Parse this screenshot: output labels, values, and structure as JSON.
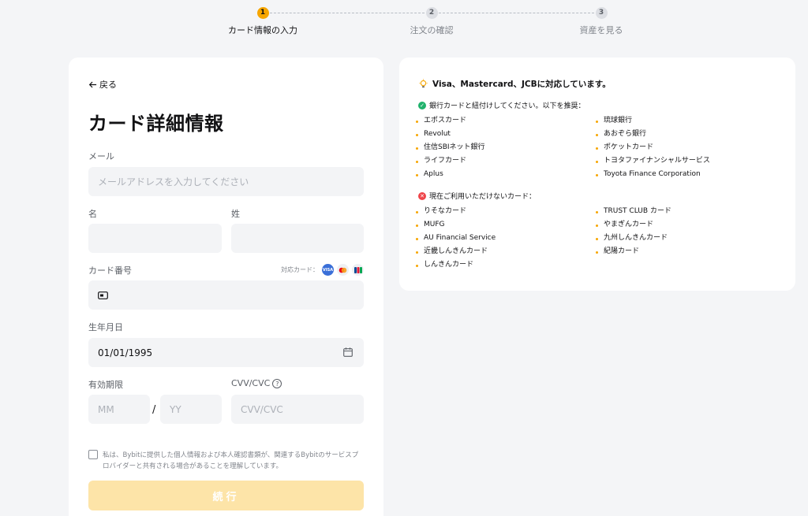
{
  "stepper": {
    "steps": [
      {
        "num": "1",
        "label": "カード情報の入力"
      },
      {
        "num": "2",
        "label": "注文の確認"
      },
      {
        "num": "3",
        "label": "資産を見る"
      }
    ]
  },
  "form": {
    "back_label": "戻る",
    "title": "カード詳細情報",
    "email_label": "メール",
    "email_placeholder": "メールアドレスを入力してください",
    "first_name_label": "名",
    "last_name_label": "姓",
    "card_number_label": "カード番号",
    "supported_cards_label": "対応カード：",
    "card_logos": [
      "VISA",
      "MC",
      "JCB"
    ],
    "dob_label": "生年月日",
    "dob_value": "01/01/1995",
    "expiry_label": "有効期限",
    "mm_placeholder": "MM",
    "slash": "/",
    "yy_placeholder": "YY",
    "cvv_label": "CVV/CVC",
    "cvv_placeholder": "CVV/CVC",
    "consent_text": "私は、Bybitに提供した個人情報および本人確認書類が、関連するBybitのサービスプロバイダーと共有される場合があることを理解しています。",
    "submit_label": "続行"
  },
  "info": {
    "title": "Visa、Mastercard、JCBに対応しています。",
    "recommended_heading": "銀行カードと紐付けしてください。以下を推奨：",
    "recommended_left": [
      "エポスカード",
      "Revolut",
      "住信SBIネット銀行",
      "ライフカード",
      "Aplus"
    ],
    "recommended_right": [
      "琉球銀行",
      "あおぞら銀行",
      "ポケットカード",
      "トヨタファイナンシャルサービス",
      "Toyota Finance Corporation"
    ],
    "unavailable_heading": "現在ご利用いただけないカード：",
    "unavailable_left": [
      "りそなカード",
      "MUFG",
      "AU Financial Service",
      "近畿しんきんカード",
      "しんきんカード"
    ],
    "unavailable_right": [
      "TRUST CLUB カード",
      "やまぎんカード",
      "九州しんきんカード",
      "紀陽カード"
    ]
  },
  "colors": {
    "accent": "#f7a600",
    "submit_disabled": "#fde4a8",
    "ok": "#20b26c",
    "ng": "#ef454a",
    "page_bg": "#f4f5f7"
  },
  "icons": {
    "back": "arrow-left-icon",
    "card": "card-icon",
    "calendar": "calendar-icon",
    "help": "help-circle-icon",
    "bulb": "lightbulb-icon",
    "check": "check-circle-icon",
    "cross": "x-circle-icon"
  }
}
